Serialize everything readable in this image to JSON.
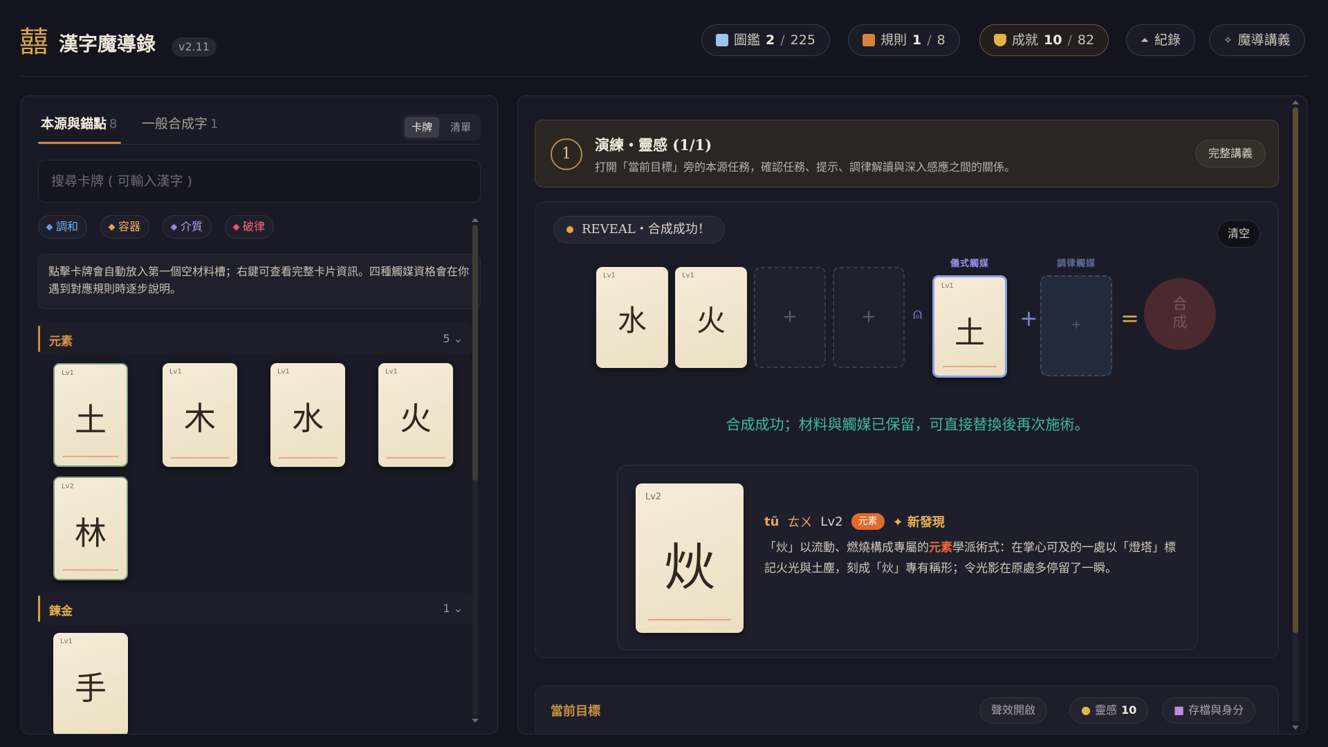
{
  "app": {
    "logo": "囍",
    "title": "漢字魔導錄",
    "version": "v2.11"
  },
  "header": {
    "codex": {
      "label": "圖鑑",
      "current": "2",
      "total": "225",
      "icon": "book-icon"
    },
    "rules": {
      "label": "規則",
      "current": "1",
      "total": "8",
      "icon": "scroll-icon"
    },
    "achievements": {
      "label": "成就",
      "current": "10",
      "total": "82",
      "icon": "trophy-icon"
    },
    "records": {
      "label": "紀錄",
      "icon": "cloud-icon"
    },
    "lectures": {
      "label": "魔導講義",
      "icon": "sparkle-icon"
    },
    "separator": "/"
  },
  "left": {
    "tabs": [
      {
        "label": "本源與錨點",
        "count": "8"
      },
      {
        "label": "一般合成字",
        "count": "1"
      }
    ],
    "view_toggle": {
      "cards": "卡牌",
      "list": "清單"
    },
    "search_placeholder": "搜尋卡牌 ( 可輸入漢字 )",
    "filters": [
      {
        "label": "調和",
        "color": "#5aa0e8"
      },
      {
        "label": "容器",
        "color": "#e8a04e"
      },
      {
        "label": "介質",
        "color": "#9a7ee8"
      },
      {
        "label": "破律",
        "color": "#e8556a"
      }
    ],
    "hint": "點擊卡牌會自動放入第一個空材料槽；右鍵可查看完整卡片資訊。四種觸媒資格會在你遇到對應規則時逐步說明。",
    "groups": [
      {
        "name": "元素",
        "count": "5",
        "cards": [
          {
            "char": "土",
            "lv": "Lv1"
          },
          {
            "char": "木",
            "lv": "Lv1"
          },
          {
            "char": "水",
            "lv": "Lv1"
          },
          {
            "char": "火",
            "lv": "Lv1"
          },
          {
            "char": "林",
            "lv": "Lv2"
          }
        ]
      },
      {
        "name": "鍊金",
        "count": "1",
        "cards": [
          {
            "char": "手",
            "lv": "Lv1"
          }
        ]
      }
    ]
  },
  "right": {
    "tutorial": {
      "step": "1",
      "title": "演練・靈感 (1/1)",
      "desc": "打開「當前目標」旁的本源任務，確認任務、提示、調律解讀與深入感應之間的關係。",
      "button": "完整講義"
    },
    "reveal": {
      "label": "REVEAL・合成成功！"
    },
    "clear_label": "清空",
    "slots": {
      "materials": [
        {
          "char": "水",
          "lv": "Lv1"
        },
        {
          "char": "火",
          "lv": "Lv1"
        }
      ],
      "empty_symbol": "+",
      "ritual_label": "儀式觸媒",
      "ritual_card": {
        "char": "土",
        "lv": "Lv1"
      },
      "tuning_label": "調律觸媒",
      "equals": "=",
      "result_placeholder": [
        "合",
        "成"
      ]
    },
    "success_message": "合成成功；材料與觸媒已保留，可直接替換後再次施術。",
    "result": {
      "char": "炏",
      "lv_card": "Lv2",
      "pinyin": "tū",
      "zhuyin": "ㄊㄨ",
      "lv": "Lv2",
      "tag": "元素",
      "new_label": "✦ 新發現",
      "desc_before": "「炏」以流動、燃燒構成專屬的",
      "desc_highlight": "元素",
      "desc_after": "學派術式：在掌心可及的一處以「燈塔」標記火光與土塵，刻成「炏」專有稱形；令光影在原處多停留了一瞬。"
    },
    "bottom": {
      "title": "當前目標",
      "sound": "聲效開啟",
      "inspiration_label": "靈感",
      "inspiration_value": "10",
      "save": "存檔與身分"
    }
  }
}
